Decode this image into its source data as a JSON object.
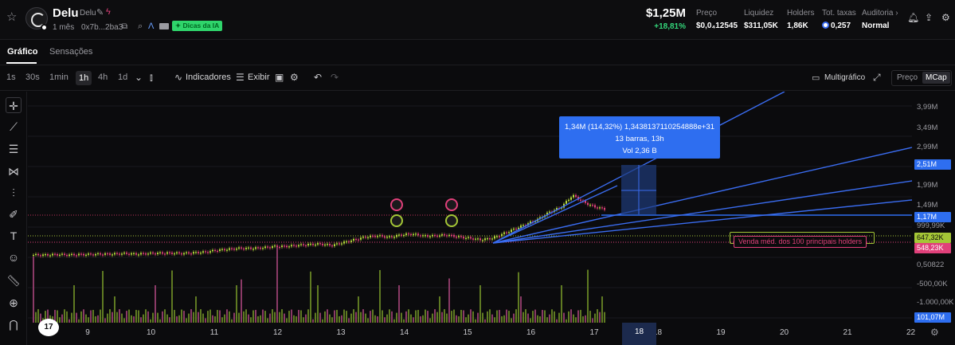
{
  "header": {
    "token_name": "Delu",
    "token_ticker": "Delu",
    "age": "1 mês",
    "address": "0x7b...2ba3",
    "ai_tips_label": "Dicas da IA",
    "mcap": "$1,25M",
    "mcap_change": "+18,81%",
    "stats": [
      {
        "label": "Preço",
        "value": "$0,0₄12545"
      },
      {
        "label": "Liquidez",
        "value": "$311,05K"
      },
      {
        "label": "Holders",
        "value": "1,86K"
      },
      {
        "label": "Tot. taxas",
        "value": "0,257"
      },
      {
        "label": "Auditoria ›",
        "value": "Normal"
      }
    ],
    "icons": [
      "star-icon",
      "edit-icon",
      "bolt-icon",
      "copy-icon",
      "search-icon",
      "delta-icon",
      "card-icon",
      "bell-icon",
      "share-icon",
      "gear-icon"
    ]
  },
  "tabs": [
    {
      "label": "Gráfico",
      "active": true
    },
    {
      "label": "Sensações",
      "active": false
    }
  ],
  "toolbar": {
    "timeframes": [
      "1s",
      "30s",
      "1min",
      "1h",
      "4h",
      "1d"
    ],
    "active_timeframe": "1h",
    "indicators_label": "Indicadores",
    "display_label": "Exibir",
    "multichart_label": "Multigráfico",
    "price_label": "Preço",
    "mcap_label": "MCap",
    "active_toggle": "MCap"
  },
  "tooltip": {
    "line1": "1,34M (114,32%) 1,3438137110254888e+31",
    "line2": "13 barras, 13h",
    "line3": "Vol 2,36 B"
  },
  "holders_label": "Venda méd. dos 100 principais holders",
  "logo_text": "17",
  "chart_data": {
    "type": "candlestick",
    "x_ticks": [
      "9",
      "10",
      "11",
      "12",
      "13",
      "14",
      "15",
      "16",
      "17",
      "18",
      "19",
      "20",
      "21",
      "22"
    ],
    "highlighted_x": "18",
    "y_ticks": [
      "3,99M",
      "3,49M",
      "2,99M",
      "1,99M",
      "1,49M",
      "999,99K",
      "0,50822",
      "-500,00K",
      "-1.000,00K"
    ],
    "price_tags": [
      {
        "label": "2,51M",
        "color": "#2e6ef0"
      },
      {
        "label": "1,17M",
        "color": "#2e6ef0"
      },
      {
        "label": "647,32K",
        "color": "#a4c636"
      },
      {
        "label": "548,23K",
        "color": "#e0407a"
      },
      {
        "label": "101,07M",
        "color": "#2e6ef0"
      }
    ],
    "close_series": [
      0.6,
      0.6,
      0.61,
      0.6,
      0.61,
      0.61,
      0.62,
      0.62,
      0.63,
      0.62,
      0.63,
      0.64,
      0.64,
      0.63,
      0.65,
      0.66,
      0.7,
      0.72,
      0.74,
      0.74,
      0.75,
      0.78,
      0.78,
      0.8,
      0.82,
      0.83,
      0.8,
      0.86,
      0.92,
      0.98,
      1.0,
      0.97,
      1.02,
      1.04,
      1.0,
      1.0,
      1.02,
      0.98,
      0.95,
      0.92,
      0.95,
      1.05,
      1.15,
      1.25,
      1.35,
      1.5,
      1.6,
      1.85,
      1.7,
      1.6,
      1.55
    ],
    "grid": true,
    "legend": "none"
  }
}
